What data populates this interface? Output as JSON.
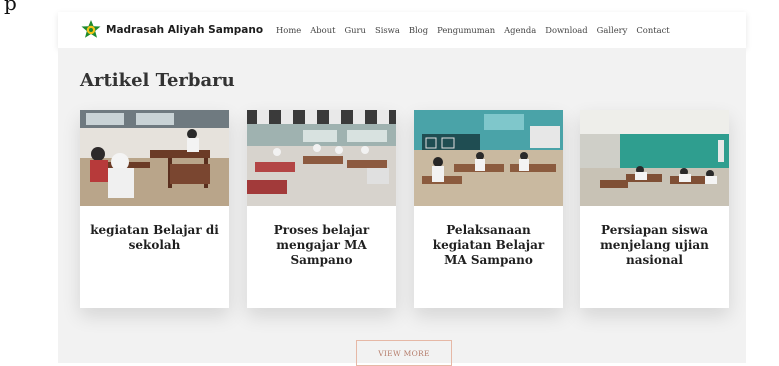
{
  "page_top_fragment": "p",
  "header": {
    "brand_name": "Madrasah Aliyah Sampano",
    "logo_icon": "green-star-emblem-icon",
    "nav": [
      "Home",
      "About",
      "Guru",
      "Siswa",
      "Blog",
      "Pengumuman",
      "Agenda",
      "Download",
      "Gallery",
      "Contact"
    ]
  },
  "section": {
    "title": "Artikel Terbaru",
    "articles": [
      {
        "title": "kegiatan Belajar di sekolah",
        "image": "classroom-photo-students-desks"
      },
      {
        "title": "Proses belajar mengajar MA Sampano",
        "image": "classroom-photo-checkered-floor"
      },
      {
        "title": "Pelaksanaan kegiatan Belajar MA Sampano",
        "image": "classroom-photo-blackboard-class-x"
      },
      {
        "title": "Persiapan siswa menjelang ujian nasional",
        "image": "classroom-photo-green-wall-exam"
      }
    ],
    "view_more_label": "VIEW MORE"
  },
  "colors": {
    "content_bg": "#f2f2f2",
    "button_border": "#e6b8a6",
    "button_text": "#b57c6a",
    "logo_green": "#1e8a2e"
  }
}
